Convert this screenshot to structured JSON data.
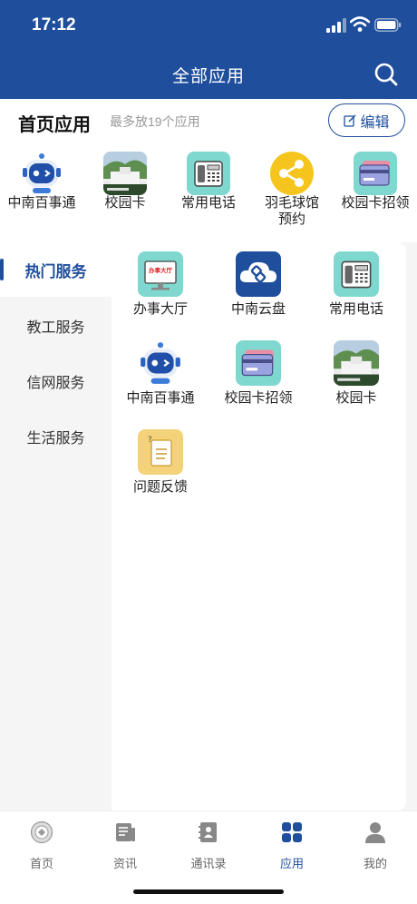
{
  "status_bar": {
    "time": "17:12"
  },
  "header": {
    "title": "全部应用"
  },
  "home_section": {
    "title": "首页应用",
    "subtitle": "最多放19个应用",
    "edit_label": "编辑",
    "items": [
      {
        "label": "中南百事通",
        "icon": "robot-icon"
      },
      {
        "label": "校园卡",
        "icon": "campus-photo-icon"
      },
      {
        "label": "常用电话",
        "icon": "telephone-icon"
      },
      {
        "label": "羽毛球馆\n预约",
        "icon": "share-icon"
      },
      {
        "label": "校园卡招领",
        "icon": "card-icon"
      }
    ]
  },
  "menu": {
    "items": [
      {
        "label": "热门服务",
        "active": true
      },
      {
        "label": "教工服务",
        "active": false
      },
      {
        "label": "信网服务",
        "active": false
      },
      {
        "label": "生活服务",
        "active": false
      }
    ]
  },
  "services": [
    {
      "label": "办事大厅",
      "icon": "office-hall-icon",
      "badge": "办事大厅"
    },
    {
      "label": "中南云盘",
      "icon": "cloud-icon"
    },
    {
      "label": "常用电话",
      "icon": "telephone-icon"
    },
    {
      "label": "中南百事通",
      "icon": "robot-icon"
    },
    {
      "label": "校园卡招领",
      "icon": "card-icon"
    },
    {
      "label": "校园卡",
      "icon": "campus-photo-icon"
    },
    {
      "label": "问题反馈",
      "icon": "feedback-icon"
    }
  ],
  "tabbar": {
    "items": [
      {
        "label": "首页",
        "active": false
      },
      {
        "label": "资讯",
        "active": false
      },
      {
        "label": "通讯录",
        "active": false
      },
      {
        "label": "应用",
        "active": true
      },
      {
        "label": "我的",
        "active": false
      }
    ]
  },
  "colors": {
    "primary": "#1f4f9c",
    "background": "#f5f5f5"
  }
}
